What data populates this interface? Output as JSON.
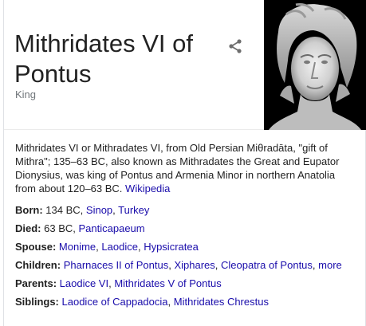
{
  "entity": {
    "title": "Mithridates VI of Pontus",
    "subtitle": "King"
  },
  "share_icon": "share-icon",
  "portrait_icon": "bust-portrait-image",
  "description": {
    "text": "Mithridates VI or Mithradates VI, from Old Persian Miθradāta, \"gift of Mithra\"; 135–63 BC, also known as Mithradates the Great and Eupator Dionysius, was king of Pontus and Armenia Minor in northern Anatolia from about 120–63 BC.",
    "source": "Wikipedia"
  },
  "facts": {
    "born": {
      "label": "Born:",
      "text": "134 BC,",
      "links": [
        "Sinop",
        "Turkey"
      ]
    },
    "died": {
      "label": "Died:",
      "text": "63 BC,",
      "links": [
        "Panticapaeum"
      ]
    },
    "spouse": {
      "label": "Spouse:",
      "links": [
        "Monime",
        "Laodice",
        "Hypsicratea"
      ]
    },
    "children": {
      "label": "Children:",
      "links": [
        "Pharnaces II of Pontus",
        "Xiphares",
        "Cleopatra of Pontus",
        "more"
      ]
    },
    "parents": {
      "label": "Parents:",
      "links": [
        "Laodice VI",
        "Mithridates V of Pontus"
      ]
    },
    "siblings": {
      "label": "Siblings:",
      "links": [
        "Laodice of Cappadocia",
        "Mithridates Chrestus"
      ]
    }
  },
  "colors": {
    "link": "#1a0dab",
    "text": "#222222",
    "muted": "#70757a"
  }
}
